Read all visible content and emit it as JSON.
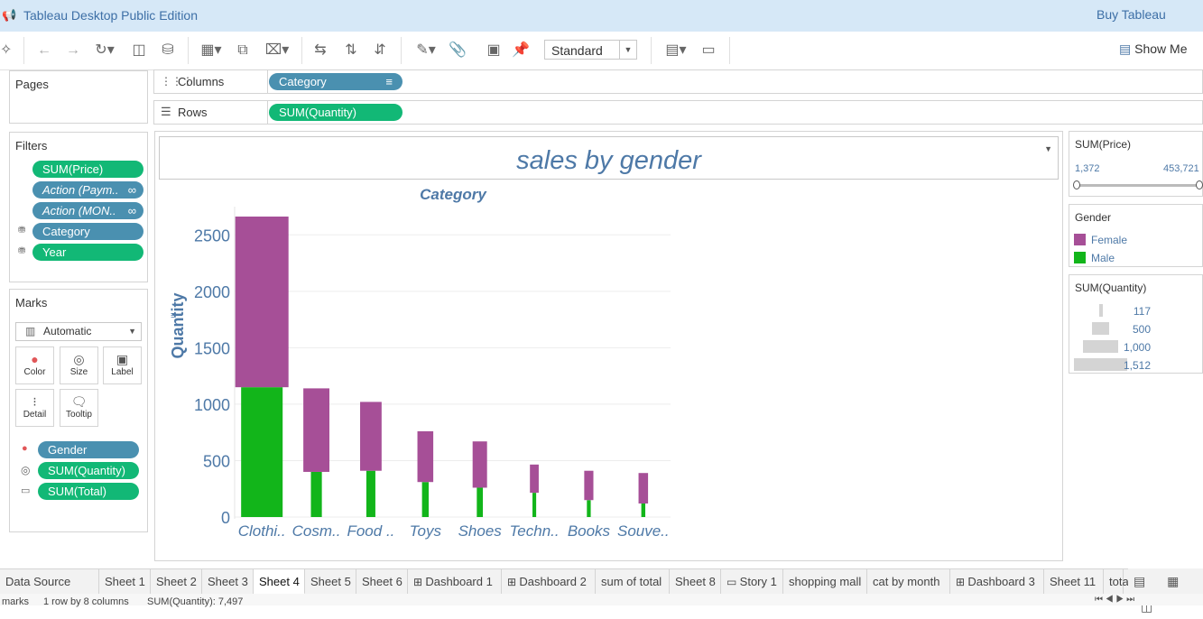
{
  "app": {
    "title": "Tableau Desktop Public Edition",
    "buy_label": "Buy Tableau"
  },
  "toolbar": {
    "standard_label": "Standard",
    "show_me_label": "Show Me"
  },
  "pages": {
    "title": "Pages"
  },
  "filters": {
    "title": "Filters",
    "items": [
      {
        "label": "SUM(Price)",
        "color": "green",
        "italic": false
      },
      {
        "label": "Action (Paym..",
        "color": "blue",
        "italic": true
      },
      {
        "label": "Action (MON..",
        "color": "blue",
        "italic": true
      },
      {
        "label": "Category",
        "color": "blue",
        "italic": false
      },
      {
        "label": "Year",
        "color": "green",
        "italic": false
      }
    ]
  },
  "marks": {
    "title": "Marks",
    "type_label": "Automatic",
    "buttons": [
      "Color",
      "Size",
      "Label",
      "Detail",
      "Tooltip"
    ],
    "fields": [
      {
        "label": "Gender",
        "icon": "color-icon",
        "color": "blue"
      },
      {
        "label": "SUM(Quantity)",
        "icon": "size-icon",
        "color": "green"
      },
      {
        "label": "SUM(Total)",
        "icon": "tooltip-icon",
        "color": "green"
      }
    ]
  },
  "shelves": {
    "columns_label": "Columns",
    "columns_pill": "Category",
    "rows_label": "Rows",
    "rows_pill": "SUM(Quantity)"
  },
  "sheet": {
    "title": "sales by gender"
  },
  "chart_data": {
    "type": "bar",
    "stacked": true,
    "title": "Category",
    "xlabel": "",
    "ylabel": "Quantity",
    "ylim": [
      0,
      2750
    ],
    "yticks": [
      0,
      500,
      1000,
      1500,
      2000,
      2500
    ],
    "ytick_labels": [
      "0",
      "500",
      "1000",
      "1500",
      "2000",
      "2500"
    ],
    "categories": [
      "Clothi..",
      "Cosm..",
      "Food ..",
      "Toys",
      "Shoes",
      "Techn..",
      "Books",
      "Souve.."
    ],
    "series": [
      {
        "name": "Male",
        "color": "#12b51a",
        "values": [
          1150,
          400,
          410,
          310,
          260,
          215,
          150,
          120
        ]
      },
      {
        "name": "Female",
        "color": "#a64f97",
        "values": [
          1512,
          740,
          610,
          450,
          410,
          250,
          260,
          270
        ]
      }
    ],
    "bar_widths": [
      1512,
      740,
      610,
      450,
      410,
      250,
      260,
      270
    ]
  },
  "legends": {
    "price": {
      "title": "SUM(Price)",
      "min": "1,372",
      "max": "453,721"
    },
    "gender": {
      "title": "Gender",
      "items": [
        {
          "label": "Female",
          "color": "#a64f97"
        },
        {
          "label": "Male",
          "color": "#12b51a"
        }
      ]
    },
    "quantity": {
      "title": "SUM(Quantity)",
      "items": [
        "117",
        "500",
        "1,000",
        "1,512"
      ]
    }
  },
  "tabs": [
    {
      "label": "Data Source"
    },
    {
      "label": "Sheet 1"
    },
    {
      "label": "Sheet 2"
    },
    {
      "label": "Sheet 3"
    },
    {
      "label": "Sheet 4",
      "active": true
    },
    {
      "label": "Sheet 5"
    },
    {
      "label": "Sheet 6"
    },
    {
      "label": "Dashboard 1",
      "icon": true
    },
    {
      "label": "Dashboard 2",
      "icon": true
    },
    {
      "label": "sum of total"
    },
    {
      "label": "Sheet 8"
    },
    {
      "label": "Story 1",
      "icon": true
    },
    {
      "label": "shopping mall"
    },
    {
      "label": "cat by month"
    },
    {
      "label": "Dashboard 3",
      "icon": true
    },
    {
      "label": "Sheet 11"
    },
    {
      "label": "tota"
    }
  ],
  "status": {
    "marks": "marks",
    "rows_cols": "1 row by 8 columns",
    "sum": "SUM(Quantity): 7,497"
  }
}
